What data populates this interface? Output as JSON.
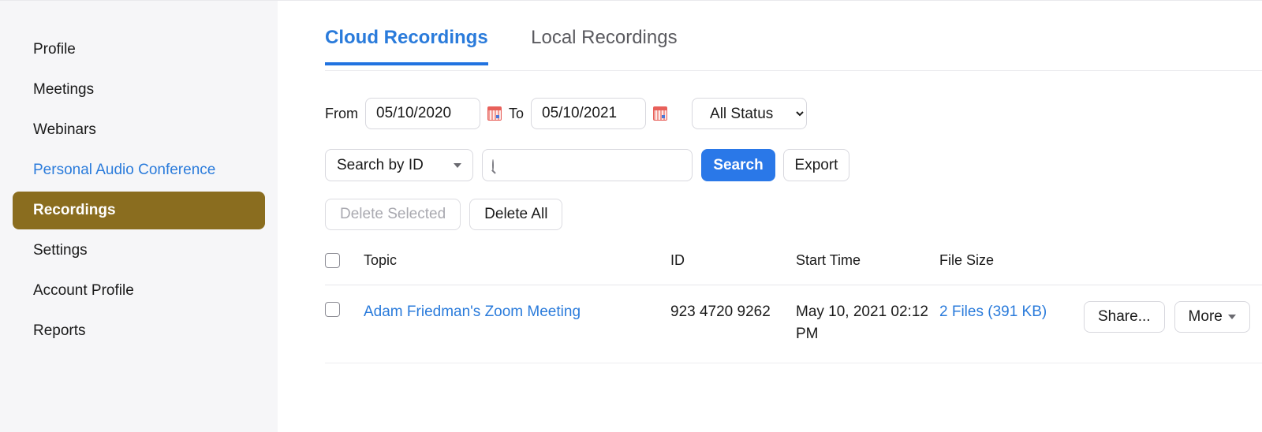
{
  "sidebar": {
    "items": [
      {
        "label": "Profile",
        "state": "normal"
      },
      {
        "label": "Meetings",
        "state": "normal"
      },
      {
        "label": "Webinars",
        "state": "normal"
      },
      {
        "label": "Personal Audio Conference",
        "state": "link"
      },
      {
        "label": "Recordings",
        "state": "active"
      },
      {
        "label": "Settings",
        "state": "normal"
      },
      {
        "label": "Account Profile",
        "state": "normal"
      },
      {
        "label": "Reports",
        "state": "normal"
      }
    ],
    "active_color": "#8a6d1f",
    "link_color": "#2a7bdb",
    "background": "#f6f6f8"
  },
  "tabs": [
    {
      "label": "Cloud Recordings",
      "active": true
    },
    {
      "label": "Local Recordings",
      "active": false
    }
  ],
  "accent_color": "#2a78e8",
  "filters": {
    "from_label": "From",
    "from_value": "05/10/2020",
    "to_label": "To",
    "to_value": "05/10/2021",
    "calendar_icon": "calendar-icon",
    "status_value": "All Status",
    "status_options": [
      "All Status"
    ]
  },
  "search": {
    "scope_value": "Search by  ID",
    "scope_options": [
      "Search by  ID"
    ],
    "input_value": "",
    "input_placeholder": "",
    "search_icon": "search-icon",
    "search_button": "Search",
    "export_button": "Export"
  },
  "bulk_actions": {
    "delete_selected": "Delete Selected",
    "delete_selected_disabled": true,
    "delete_all": "Delete All"
  },
  "table": {
    "headers": {
      "topic": "Topic",
      "id": "ID",
      "start_time": "Start Time",
      "file_size": "File Size"
    },
    "rows": [
      {
        "topic": "Adam Friedman's Zoom Meeting",
        "id": "923 4720 9262",
        "start_time": "May 10, 2021 02:12 PM",
        "file_size": "2 Files (391 KB)",
        "share_button": "Share...",
        "more_button": "More"
      }
    ]
  }
}
